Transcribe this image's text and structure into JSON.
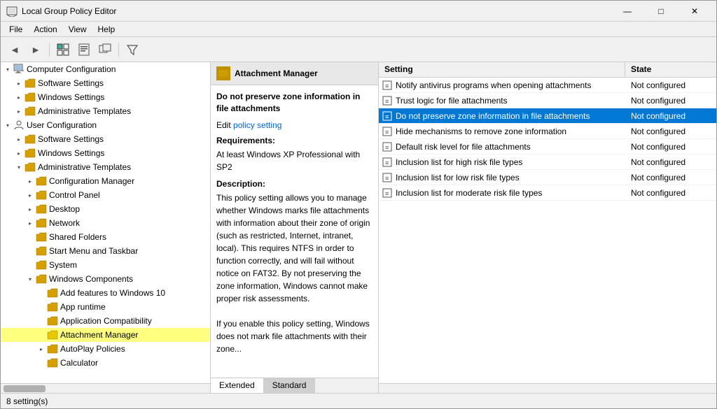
{
  "window": {
    "title": "Local Group Policy Editor",
    "min_label": "—",
    "max_label": "□",
    "close_label": "✕"
  },
  "menubar": {
    "items": [
      {
        "label": "File"
      },
      {
        "label": "Action"
      },
      {
        "label": "View"
      },
      {
        "label": "Help"
      }
    ]
  },
  "toolbar": {
    "buttons": [
      {
        "name": "back-button",
        "icon": "◄"
      },
      {
        "name": "forward-button",
        "icon": "►"
      },
      {
        "name": "up-button",
        "icon": "↑"
      },
      {
        "name": "show-hide-button",
        "icon": "⊞"
      },
      {
        "name": "properties-button",
        "icon": "📋"
      },
      {
        "name": "new-window-button",
        "icon": "🗗"
      },
      {
        "name": "filter-button",
        "icon": "⊟"
      }
    ]
  },
  "tree": {
    "items": [
      {
        "id": "computer-config",
        "label": "Computer Configuration",
        "level": 0,
        "type": "computer",
        "arrow": "expanded"
      },
      {
        "id": "sw-settings-1",
        "label": "Software Settings",
        "level": 1,
        "type": "folder",
        "arrow": "collapsed"
      },
      {
        "id": "win-settings-1",
        "label": "Windows Settings",
        "level": 1,
        "type": "folder",
        "arrow": "collapsed"
      },
      {
        "id": "admin-templates-1",
        "label": "Administrative Templates",
        "level": 1,
        "type": "folder",
        "arrow": "collapsed"
      },
      {
        "id": "user-config",
        "label": "User Configuration",
        "level": 0,
        "type": "user",
        "arrow": "expanded"
      },
      {
        "id": "sw-settings-2",
        "label": "Software Settings",
        "level": 1,
        "type": "folder",
        "arrow": "collapsed"
      },
      {
        "id": "win-settings-2",
        "label": "Windows Settings",
        "level": 1,
        "type": "folder",
        "arrow": "collapsed"
      },
      {
        "id": "admin-templates-2",
        "label": "Administrative Templates",
        "level": 1,
        "type": "folder",
        "arrow": "expanded"
      },
      {
        "id": "config-manager",
        "label": "Configuration Manager",
        "level": 2,
        "type": "folder",
        "arrow": "collapsed"
      },
      {
        "id": "control-panel",
        "label": "Control Panel",
        "level": 2,
        "type": "folder",
        "arrow": "collapsed"
      },
      {
        "id": "desktop",
        "label": "Desktop",
        "level": 2,
        "type": "folder",
        "arrow": "collapsed"
      },
      {
        "id": "network",
        "label": "Network",
        "level": 2,
        "type": "folder",
        "arrow": "collapsed"
      },
      {
        "id": "shared-folders",
        "label": "Shared Folders",
        "level": 2,
        "type": "folder",
        "arrow": "collapsed"
      },
      {
        "id": "start-menu",
        "label": "Start Menu and Taskbar",
        "level": 2,
        "type": "folder",
        "arrow": "collapsed"
      },
      {
        "id": "system",
        "label": "System",
        "level": 2,
        "type": "folder",
        "arrow": "collapsed"
      },
      {
        "id": "windows-components",
        "label": "Windows Components",
        "level": 2,
        "type": "folder",
        "arrow": "expanded"
      },
      {
        "id": "add-features",
        "label": "Add features to Windows 10",
        "level": 3,
        "type": "folder",
        "arrow": "collapsed"
      },
      {
        "id": "app-runtime",
        "label": "App runtime",
        "level": 3,
        "type": "folder",
        "arrow": "collapsed"
      },
      {
        "id": "app-compat",
        "label": "Application Compatibility",
        "level": 3,
        "type": "folder",
        "arrow": "collapsed"
      },
      {
        "id": "attach-mgr",
        "label": "Attachment Manager",
        "level": 3,
        "type": "folder-yellow",
        "arrow": "leaf",
        "selected": true
      },
      {
        "id": "autoplay",
        "label": "AutoPlay Policies",
        "level": 3,
        "type": "folder",
        "arrow": "collapsed"
      },
      {
        "id": "calculator",
        "label": "Calculator",
        "level": 3,
        "type": "folder",
        "arrow": "collapsed"
      }
    ]
  },
  "desc_panel": {
    "header": {
      "icon_color": "#c09000",
      "title": "Attachment Manager"
    },
    "policy_title": "Do not preserve zone information in file attachments",
    "edit_label": "Edit",
    "edit_link_text": "policy setting",
    "requirements_label": "Requirements:",
    "requirements_value": "At least Windows XP Professional with SP2",
    "description_label": "Description:",
    "description_text": "This policy setting allows you to manage whether Windows marks file attachments with information about their zone of origin (such as restricted, Internet, intranet, local). This requires NTFS in order to function correctly, and will fail without notice on FAT32. By not preserving the zone information, Windows cannot make proper risk assessments.\n\nIf you enable this policy setting, Windows does not mark file attachments with their zone..."
  },
  "settings_panel": {
    "col_setting": "Setting",
    "col_state": "State",
    "rows": [
      {
        "name": "Notify antivirus programs when opening attachments",
        "state": "Not configured",
        "selected": false
      },
      {
        "name": "Trust logic for file attachments",
        "state": "Not configured",
        "selected": false
      },
      {
        "name": "Do not preserve zone information in file attachments",
        "state": "Not configured",
        "selected": true
      },
      {
        "name": "Hide mechanisms to remove zone information",
        "state": "Not configured",
        "selected": false
      },
      {
        "name": "Default risk level for file attachments",
        "state": "Not configured",
        "selected": false
      },
      {
        "name": "Inclusion list for high risk file types",
        "state": "Not configured",
        "selected": false
      },
      {
        "name": "Inclusion list for low risk file types",
        "state": "Not configured",
        "selected": false
      },
      {
        "name": "Inclusion list for moderate risk file types",
        "state": "Not configured",
        "selected": false
      }
    ]
  },
  "tabs": {
    "extended_label": "Extended",
    "standard_label": "Standard"
  },
  "status_bar": {
    "text": "8 setting(s)"
  }
}
